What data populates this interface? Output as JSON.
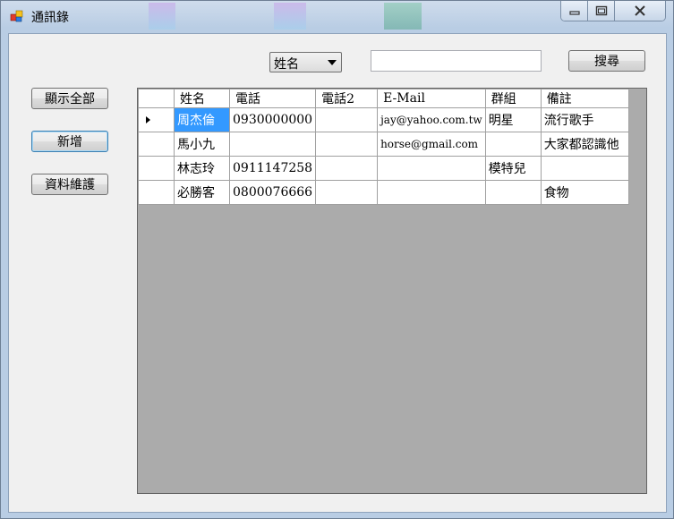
{
  "window": {
    "title": "通訊錄"
  },
  "toolbar": {
    "search_field_selected": "姓名",
    "search_value": "",
    "search_button_label": "搜尋"
  },
  "sidebar": {
    "show_all_label": "顯示全部",
    "add_label": "新增",
    "maintain_label": "資料維護"
  },
  "grid": {
    "columns": [
      "姓名",
      "電話",
      "電話2",
      "E-Mail",
      "群組",
      "備註"
    ],
    "rows": [
      [
        "周杰倫",
        "0930000000",
        "",
        "jay@yahoo.com.tw",
        "明星",
        "流行歌手"
      ],
      [
        "馬小九",
        "",
        "",
        "horse@gmail.com",
        "",
        "大家都認識他"
      ],
      [
        "林志玲",
        "0911147258",
        "",
        "",
        "模特兒",
        ""
      ],
      [
        "必勝客",
        "0800076666",
        "",
        "",
        "",
        "食物"
      ]
    ],
    "current_row": 0,
    "selected_cell": [
      0,
      0
    ]
  },
  "colors": {
    "selection": "#3399ff",
    "grid_background": "#ababab",
    "form_background": "#f0f0f0"
  }
}
